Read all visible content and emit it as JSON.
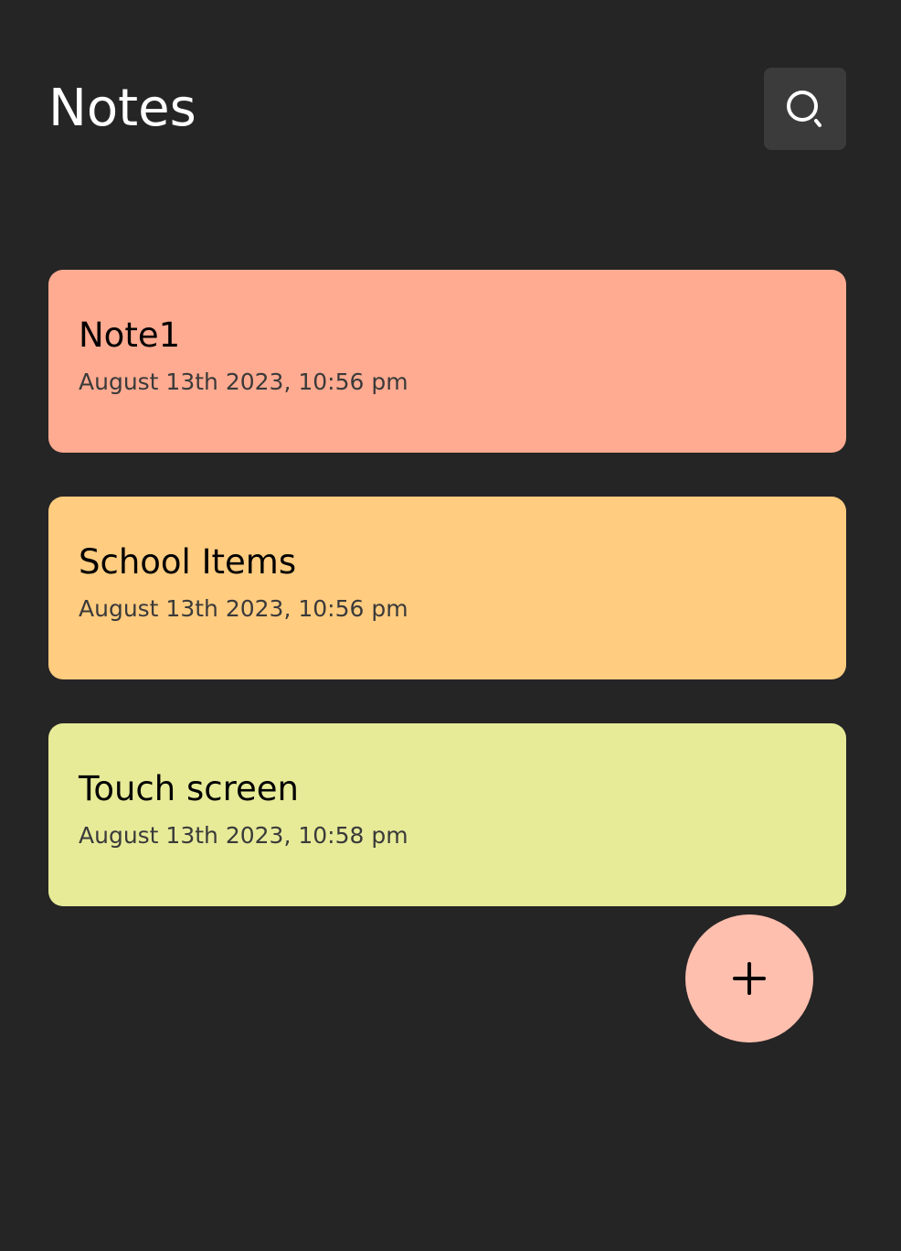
{
  "app": {
    "title": "Notes"
  },
  "header": {
    "search_icon": "search-icon",
    "search_button_bg": "#3b3b3b"
  },
  "notes": [
    {
      "title": "Note1",
      "date": "August 13th 2023, 10:56 pm",
      "color": "#ffab91"
    },
    {
      "title": "School Items",
      "date": "August 13th 2023, 10:56 pm",
      "color": "#ffcc80"
    },
    {
      "title": "Touch screen",
      "date": "August 13th 2023, 10:58 pm",
      "color": "#e7eb98"
    }
  ],
  "fab": {
    "icon": "plus-icon",
    "color": "#ffbfae"
  },
  "colors": {
    "background": "#252525",
    "title_text": "#ffffff"
  }
}
